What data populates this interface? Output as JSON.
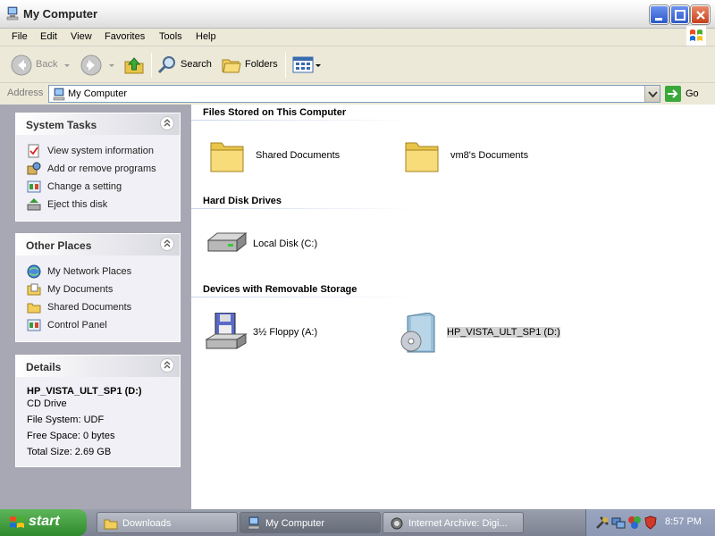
{
  "window": {
    "title": "My Computer"
  },
  "menu": [
    "File",
    "Edit",
    "View",
    "Favorites",
    "Tools",
    "Help"
  ],
  "toolbar": {
    "back": "Back",
    "search": "Search",
    "folders": "Folders"
  },
  "address": {
    "label": "Address",
    "value": "My Computer",
    "go": "Go"
  },
  "panels": {
    "system_tasks": {
      "title": "System Tasks",
      "items": [
        "View system information",
        "Add or remove programs",
        "Change a setting",
        "Eject this disk"
      ]
    },
    "other_places": {
      "title": "Other Places",
      "items": [
        "My Network Places",
        "My Documents",
        "Shared Documents",
        "Control Panel"
      ]
    },
    "details": {
      "title": "Details",
      "name": "HP_VISTA_ULT_SP1 (D:)",
      "type": "CD Drive",
      "file_system": "File System: UDF",
      "free_space": "Free Space: 0 bytes",
      "total_size": "Total Size: 2.69 GB"
    }
  },
  "sections": {
    "files": {
      "title": "Files Stored on This Computer",
      "items": [
        "Shared Documents",
        "vm8's Documents"
      ]
    },
    "hdd": {
      "title": "Hard Disk Drives",
      "items": [
        "Local Disk (C:)"
      ]
    },
    "removable": {
      "title": "Devices with Removable Storage",
      "items": [
        "3½ Floppy (A:)",
        "HP_VISTA_ULT_SP1 (D:)"
      ]
    }
  },
  "taskbar": {
    "start": "start",
    "tasks": [
      "Downloads",
      "My Computer",
      "Internet Archive: Digi..."
    ],
    "clock": "8:57 PM"
  },
  "colors": {
    "selection": "#d4d4d4",
    "start_green": "#3c9a38"
  }
}
